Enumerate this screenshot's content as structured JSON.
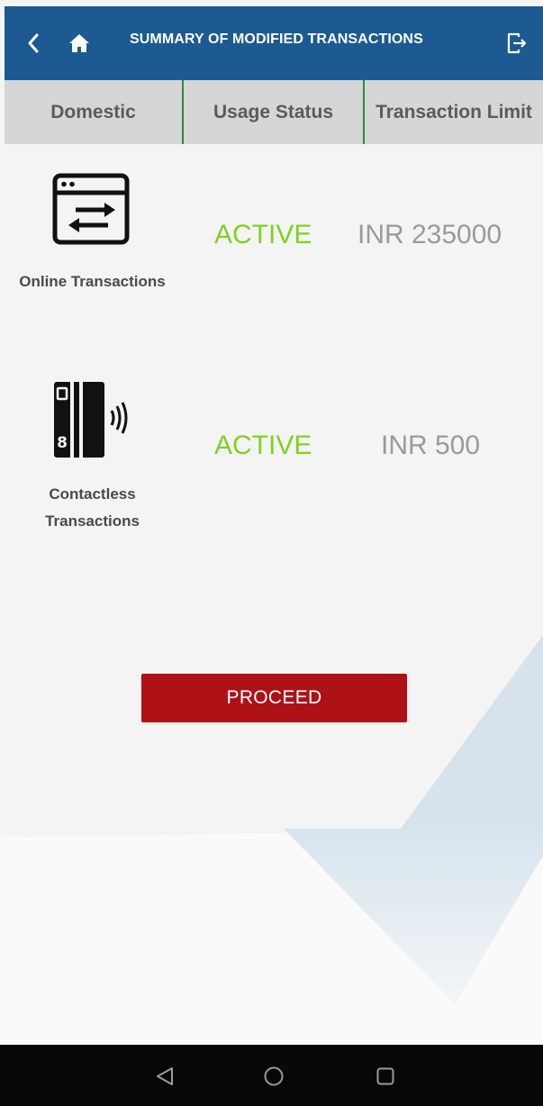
{
  "header": {
    "title": "SUMMARY OF MODIFIED TRANSACTIONS",
    "back_icon": "chevron-left-icon",
    "home_icon": "home-icon",
    "logout_icon": "logout-icon",
    "background_color": "#1d5a93"
  },
  "tabs": [
    {
      "label": "Domestic"
    },
    {
      "label": "Usage Status"
    },
    {
      "label": "Transaction Limit"
    }
  ],
  "rows": [
    {
      "icon": "online-transfer-icon",
      "label": "Online Transactions",
      "status": "ACTIVE",
      "limit": "INR 235000"
    },
    {
      "icon": "contactless-card-icon",
      "label_line1": "Contactless",
      "label_line2": "Transactions",
      "status": "ACTIVE",
      "limit": "INR 500"
    }
  ],
  "proceed": {
    "label": "PROCEED",
    "color": "#ad1116"
  },
  "colors": {
    "status_active": "#7ed321",
    "limit_text": "#9a9a9a",
    "tab_divider": "#2e8b3b"
  },
  "navbar": {
    "back_icon": "nav-back-icon",
    "home_icon": "nav-home-icon",
    "recents_icon": "nav-recents-icon"
  }
}
